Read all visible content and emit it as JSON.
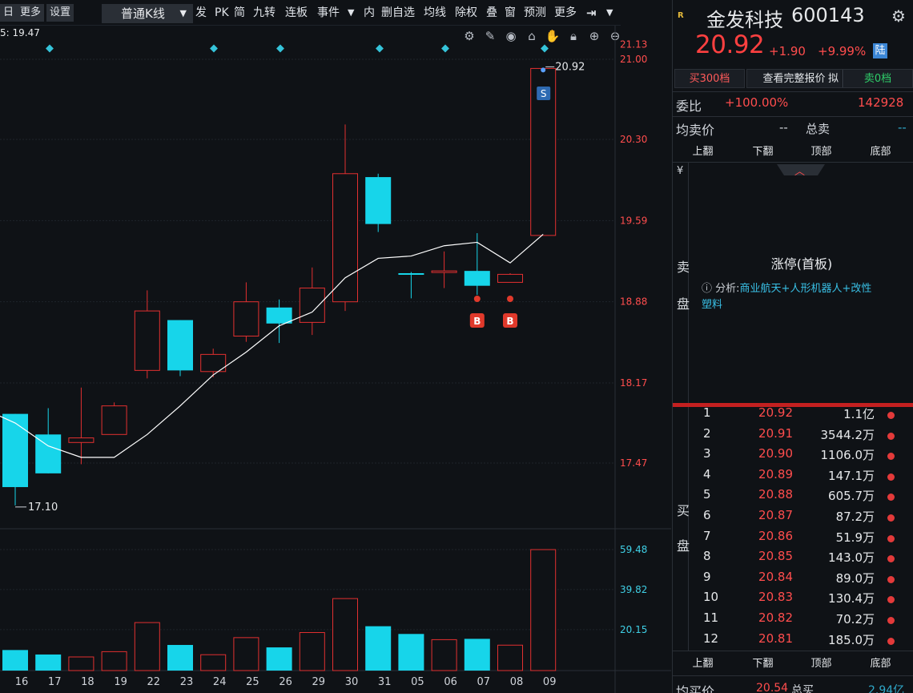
{
  "toolbar": {
    "left_items": [
      "日",
      "更多",
      "设置"
    ],
    "period_select": "普通K线",
    "items": [
      "发",
      "PK",
      "简",
      "九转",
      "连板",
      "事件",
      "内",
      "删自选",
      "均线",
      "除权",
      "叠",
      "窗",
      "预测",
      "更多"
    ]
  },
  "chart": {
    "info_line": "5: 19.47",
    "y_axis_labels": [
      "21.13",
      "21.00",
      "20.30",
      "19.59",
      "18.88",
      "18.17",
      "17.47"
    ],
    "volume_axis_labels": [
      "59.48",
      "39.82",
      "20.15"
    ],
    "x_labels": [
      "16",
      "17",
      "18",
      "19",
      "22",
      "23",
      "24",
      "25",
      "26",
      "29",
      "30",
      "31",
      "05",
      "06",
      "07",
      "08",
      "09"
    ],
    "high_marker": "20.92",
    "low_marker": "17.10",
    "signal_sell": "S",
    "signal_buy": "B",
    "colors": {
      "up": "#e23030",
      "down": "#17d5ea",
      "ma": "#ffffff",
      "bg": "#0f1216"
    },
    "icons": [
      "gear-icon",
      "brush-icon",
      "eye-icon",
      "basket-icon",
      "hand-icon",
      "lock-icon",
      "zoom-in-icon",
      "zoom-out-icon"
    ]
  },
  "chart_data": {
    "type": "candlestick",
    "categories": [
      "16",
      "17",
      "18",
      "19",
      "22",
      "23",
      "24",
      "25",
      "26",
      "29",
      "30",
      "31",
      "05",
      "06",
      "07",
      "08",
      "09"
    ],
    "open": [
      17.9,
      17.72,
      17.65,
      17.72,
      18.28,
      18.72,
      18.27,
      18.58,
      18.83,
      18.7,
      18.88,
      19.97,
      19.13,
      19.15,
      19.15,
      19.05,
      19.46
    ],
    "high": [
      17.9,
      17.95,
      18.13,
      18.0,
      18.98,
      18.72,
      18.47,
      19.05,
      18.9,
      19.18,
      20.43,
      20.0,
      19.14,
      19.32,
      19.48,
      19.13,
      20.92
    ],
    "low": [
      17.1,
      17.38,
      17.46,
      17.73,
      18.21,
      18.23,
      18.22,
      18.53,
      18.52,
      18.59,
      18.8,
      19.49,
      18.91,
      19.0,
      18.94,
      19.05,
      19.46
    ],
    "close": [
      17.26,
      17.38,
      17.69,
      17.97,
      18.8,
      18.28,
      18.42,
      18.88,
      18.69,
      19.0,
      20.0,
      19.56,
      19.12,
      19.15,
      19.02,
      19.12,
      20.92
    ],
    "ma5": [
      17.82,
      17.62,
      17.52,
      17.52,
      17.72,
      17.97,
      18.24,
      18.44,
      18.67,
      18.79,
      19.09,
      19.26,
      19.28,
      19.37,
      19.4,
      19.22,
      19.47
    ],
    "volume": [
      10.1,
      7.9,
      6.7,
      9.3,
      23.6,
      12.6,
      7.8,
      16.2,
      11.4,
      18.7,
      35.4,
      21.8,
      18.0,
      15.2,
      15.6,
      12.5,
      59.48
    ],
    "ylim": [
      17.0,
      21.13
    ],
    "volume_ylim": [
      0,
      59.48
    ]
  },
  "panel": {
    "badge": "R",
    "stock_name": "金发科技",
    "stock_code": "600143",
    "price": "20.92",
    "change": "+1.90",
    "change_pct": "+9.99%",
    "exchange_badge": "陆",
    "buttons": [
      "买300档",
      "查看完整报价",
      "拟",
      "卖0档"
    ],
    "weibi_label": "委比",
    "weibi_pct": "+100.00%",
    "weibi_value": "142928",
    "avg_sell_label": "均卖价",
    "avg_sell_value": "--",
    "total_sell_label": "总卖",
    "total_sell_value": "--",
    "nav": [
      "上翻",
      "下翻",
      "顶部",
      "底部"
    ],
    "yen_icon": "¥",
    "sell_side_label": [
      "卖",
      "盘"
    ],
    "limit_title": "涨停(首板)",
    "analysis_prefix": "分析:",
    "analysis_text": "商业航天+人形机器人+改性塑料",
    "buy_side_label": [
      "买",
      "盘"
    ],
    "buy_levels": [
      {
        "idx": "1",
        "price": "20.92",
        "vol": "1.1亿"
      },
      {
        "idx": "2",
        "price": "20.91",
        "vol": "3544.2万"
      },
      {
        "idx": "3",
        "price": "20.90",
        "vol": "1106.0万"
      },
      {
        "idx": "4",
        "price": "20.89",
        "vol": "147.1万"
      },
      {
        "idx": "5",
        "price": "20.88",
        "vol": "605.7万"
      },
      {
        "idx": "6",
        "price": "20.87",
        "vol": "87.2万"
      },
      {
        "idx": "7",
        "price": "20.86",
        "vol": "51.9万"
      },
      {
        "idx": "8",
        "price": "20.85",
        "vol": "143.0万"
      },
      {
        "idx": "9",
        "price": "20.84",
        "vol": "89.0万"
      },
      {
        "idx": "10",
        "price": "20.83",
        "vol": "130.4万"
      },
      {
        "idx": "11",
        "price": "20.82",
        "vol": "70.2万"
      },
      {
        "idx": "12",
        "price": "20.81",
        "vol": "185.0万"
      }
    ],
    "avg_buy_label": "均买价",
    "avg_buy_value": "20.54",
    "total_buy_label": "总买",
    "total_buy_value": "2.94亿"
  }
}
